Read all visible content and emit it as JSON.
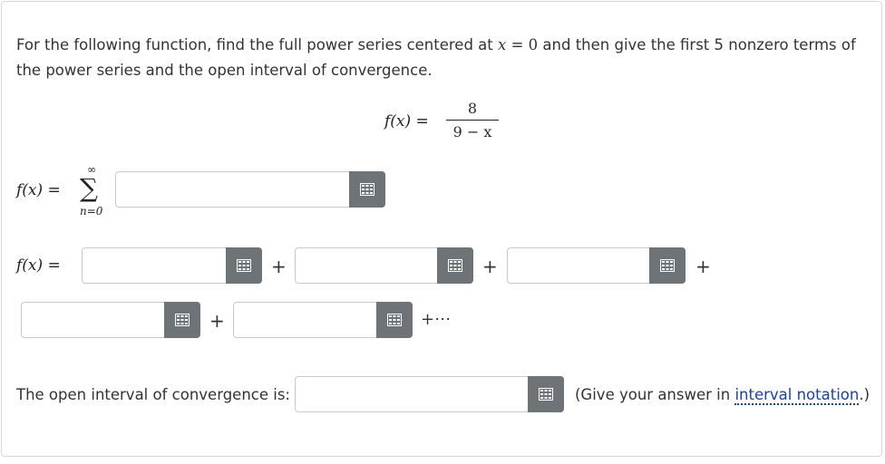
{
  "prompt": {
    "part1": "For the following function, find the full power series centered at ",
    "var": "x",
    "eq": " = 0",
    "part2": " and then give the first 5 nonzero terms of the power series and the open interval of convergence."
  },
  "function": {
    "lhs": "f(x) =",
    "numerator": "8",
    "denominator": "9 − x"
  },
  "series": {
    "lhs": "f(x) =",
    "sigma": "∑",
    "upper": "∞",
    "lower": "n=0"
  },
  "terms_row": {
    "lhs": "f(x) ="
  },
  "plus": "+",
  "tail": "+⋯",
  "interval": {
    "label": "The open interval of convergence is:",
    "note_before": "(Give your answer in ",
    "note_link": "interval notation",
    "note_after": ".)"
  },
  "icons": {
    "keypad": "keypad-icon"
  },
  "colors": {
    "keypad_bg": "#6e7378",
    "link": "#1c3fa8",
    "border": "#c9c9c9"
  }
}
